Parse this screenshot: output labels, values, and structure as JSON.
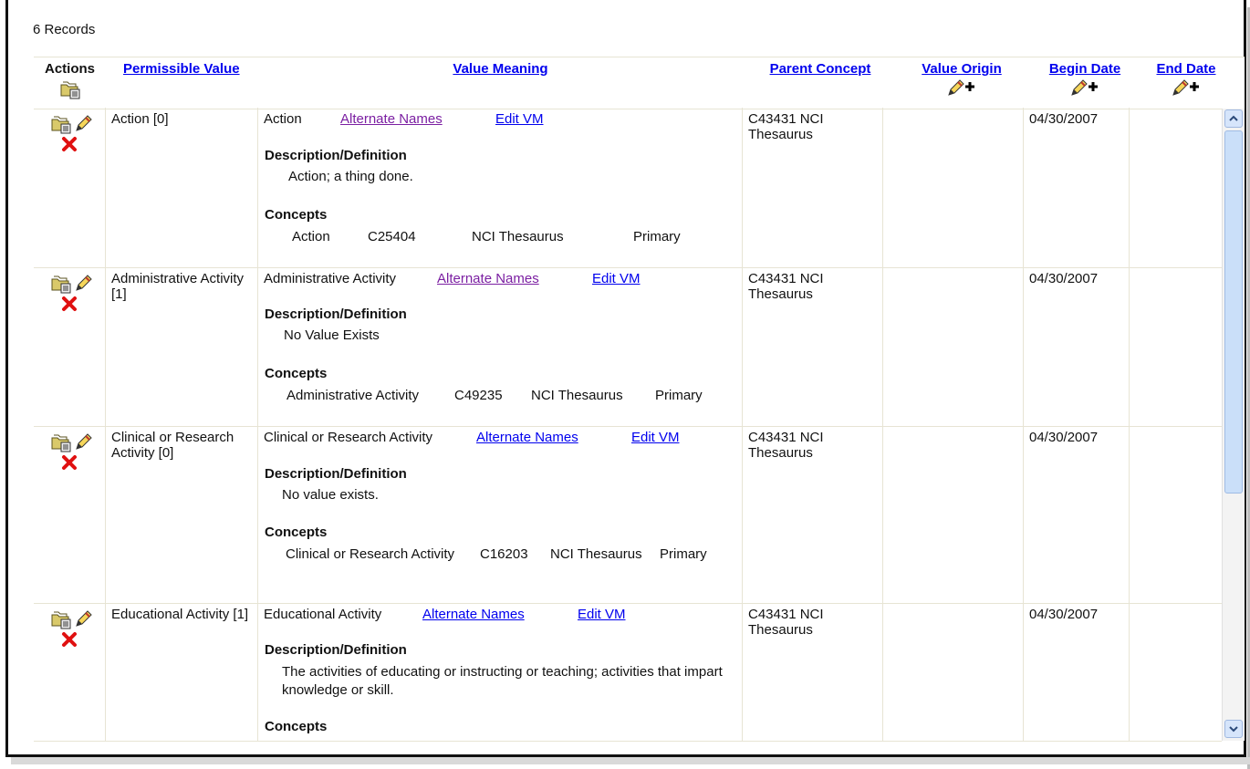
{
  "records_label": "6 Records",
  "headers": {
    "actions": "Actions",
    "permissible_value": "Permissible Value",
    "value_meaning": "Value Meaning",
    "parent_concept": "Parent Concept",
    "value_origin": "Value Origin",
    "begin_date": "Begin Date",
    "end_date": "End Date"
  },
  "labels": {
    "alternate_names": "Alternate Names ",
    "edit_vm": "Edit VM ",
    "description": "Description/Definition",
    "concepts": "Concepts"
  },
  "rows": [
    {
      "pv": "Action [0]",
      "vm": "Action",
      "alt_visited": true,
      "description": "Action; a thing done.",
      "concept": {
        "name": "Action",
        "code": "C25404",
        "source": "NCI Thesaurus",
        "type": "Primary"
      },
      "parent_concept": "C43431 NCI Thesaurus",
      "value_origin": "",
      "begin_date": "04/30/2007",
      "end_date": ""
    },
    {
      "pv": "Administrative Activity [1]",
      "vm": "Administrative Activity",
      "alt_visited": true,
      "description": "No Value Exists",
      "concept": {
        "name": "Administrative Activity",
        "code": "C49235",
        "source": "NCI Thesaurus",
        "type": "Primary"
      },
      "parent_concept": "C43431 NCI Thesaurus",
      "value_origin": "",
      "begin_date": "04/30/2007",
      "end_date": ""
    },
    {
      "pv": "Clinical or Research Activity [0]",
      "vm": "Clinical or Research Activity",
      "alt_visited": false,
      "description": "No value exists.",
      "concept": {
        "name": "Clinical or Research Activity",
        "code": "C16203",
        "source": "NCI Thesaurus",
        "type": "Primary"
      },
      "parent_concept": "C43431 NCI Thesaurus",
      "value_origin": "",
      "begin_date": "04/30/2007",
      "end_date": ""
    },
    {
      "pv": "Educational Activity [1]",
      "vm": "Educational Activity",
      "alt_visited": false,
      "description": "The activities of educating or instructing or teaching; activities that impart knowledge or skill.",
      "concept": {
        "name": "",
        "code": "",
        "source": "",
        "type": ""
      },
      "parent_concept": "C43431 NCI Thesaurus",
      "value_origin": "",
      "begin_date": "04/30/2007",
      "end_date": ""
    }
  ],
  "icons": {
    "folder": "folder-details-icon",
    "edit": "edit-pencil-icon",
    "delete": "delete-x-icon",
    "add": "edit-add-icon"
  },
  "colors": {
    "link": "#0000ee",
    "visited": "#7b1fa2",
    "grid_line": "#e7e4d4",
    "delete": "#e01010"
  }
}
